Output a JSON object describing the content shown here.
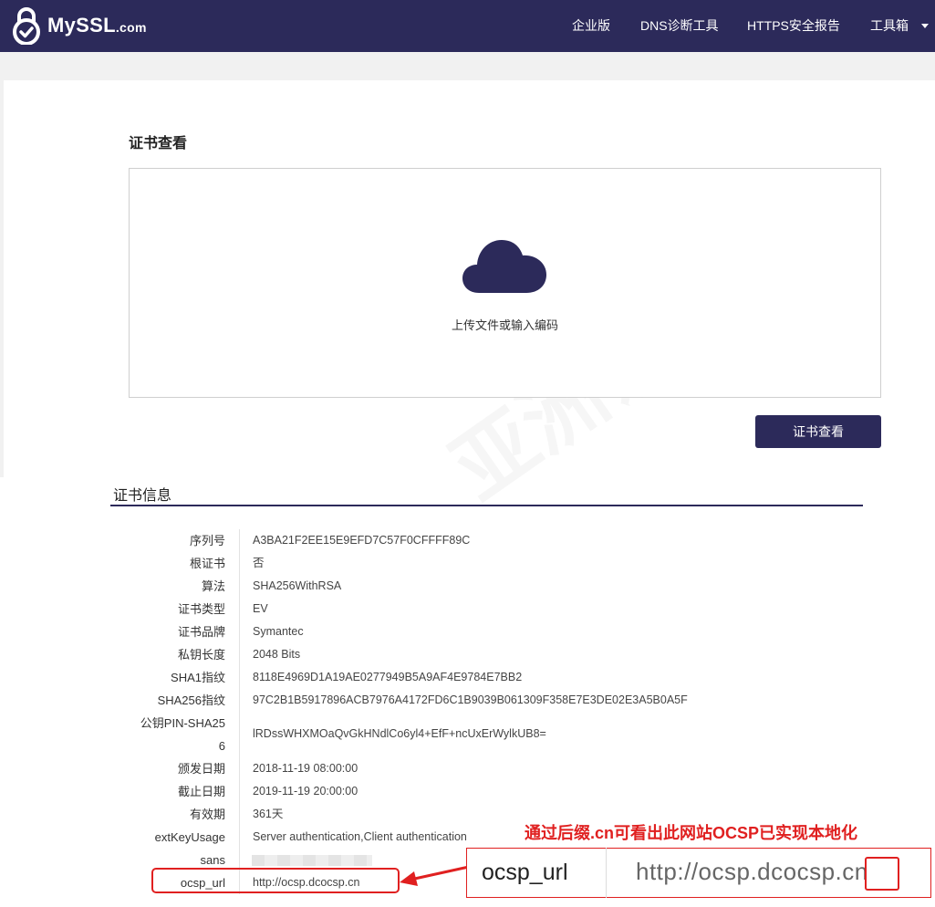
{
  "brand": {
    "name_prefix": "My",
    "name_main": "SSL",
    "name_suffix": ".com"
  },
  "nav": {
    "items": [
      "企业版",
      "DNS诊断工具",
      "HTTPS安全报告",
      "工具箱"
    ]
  },
  "viewer": {
    "title": "证书查看",
    "upload_text": "上传文件或输入编码",
    "button": "证书查看"
  },
  "watermark": "亚洲诚信",
  "info": {
    "title": "证书信息",
    "rows": [
      {
        "label": "序列号",
        "value": "A3BA21F2EE15E9EFD7C57F0CFFFF89C"
      },
      {
        "label": "根证书",
        "value": "否"
      },
      {
        "label": "算法",
        "value": "SHA256WithRSA"
      },
      {
        "label": "证书类型",
        "value": "EV"
      },
      {
        "label": "证书品牌",
        "value": "Symantec"
      },
      {
        "label": "私钥长度",
        "value": "2048 Bits"
      },
      {
        "label": "SHA1指纹",
        "value": "8118E4969D1A19AE0277949B5A9AF4E9784E7BB2"
      },
      {
        "label": "SHA256指纹",
        "value": "97C2B1B5917896ACB7976A4172FD6C1B9039B061309F358E7E3DE02E3A5B0A5F"
      },
      {
        "label": "公钥PIN-SHA256",
        "label_line1": "公钥PIN-SHA25",
        "label_line2": "6",
        "value": "lRDssWHXMOaQvGkHNdlCo6yl4+EfF+ncUxErWylkUB8="
      },
      {
        "label": "颁发日期",
        "value": "2018-11-19 08:00:00"
      },
      {
        "label": "截止日期",
        "value": "2019-11-19 20:00:00"
      },
      {
        "label": "有效期",
        "value": "361天"
      },
      {
        "label": "extKeyUsage",
        "value": "Server authentication,Client authentication"
      },
      {
        "label": "sans",
        "value": ""
      },
      {
        "label": "ocsp_url",
        "value": "http://ocsp.dcocsp.cn"
      }
    ]
  },
  "annotation": {
    "text": "通过后缀.cn可看出此网站OCSP已实现本地化",
    "zoom_label": "ocsp_url",
    "zoom_value_prefix": "http://ocsp.dcocsp.",
    "zoom_value_highlight": "cn",
    "color": "#e02020"
  },
  "colors": {
    "brand": "#2c2a5a",
    "accent_red": "#e02020"
  }
}
